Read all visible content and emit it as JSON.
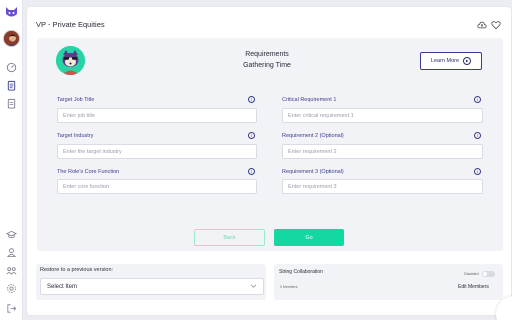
{
  "header": {
    "title": "VP - Private Equities"
  },
  "panel": {
    "heading_line1": "Requirements",
    "heading_line2": "Gathering Time",
    "learn_more_label": "Learn More"
  },
  "form": {
    "left": [
      {
        "label": "Target Job Title",
        "placeholder": "Enter job title"
      },
      {
        "label": "Target Industry",
        "placeholder": "Enter the target industry"
      },
      {
        "label": "The Role's Core Function",
        "placeholder": "Enter core function"
      }
    ],
    "right": [
      {
        "label": "Critical Requirement 1",
        "placeholder": "Enter critical requirement 1"
      },
      {
        "label": "Requirement 2 (Optional)",
        "placeholder": "Enter requirement 2"
      },
      {
        "label": "Requirement 3 (Optional)",
        "placeholder": "Enter requirement 3"
      }
    ],
    "info_glyph": "i"
  },
  "actions": {
    "back_label": "Back",
    "go_label": "Go"
  },
  "restore": {
    "label": "Restore to a previous version:",
    "selected": "Select Item"
  },
  "collaboration": {
    "title": "String Collaboration",
    "toggle_label": "Disabled",
    "toggle_on": false,
    "members_text": "0 Members",
    "edit_label": "Edit Members"
  },
  "colors": {
    "accent": "#13d8a1",
    "brand_purple": "#3a3d8f",
    "logo_purple": "#6b4ed6"
  },
  "icons": {
    "sidebar_top": [
      "app-logo-icon",
      "avatar"
    ],
    "sidebar_nav": [
      "dashboard-icon",
      "clipboard-icon",
      "document-icon"
    ],
    "sidebar_bottom": [
      "graduation-cap-icon",
      "user-badge-icon",
      "team-icon",
      "settings-icon",
      "logout-icon"
    ],
    "header": [
      "cloud-upload-icon",
      "heart-icon"
    ]
  }
}
